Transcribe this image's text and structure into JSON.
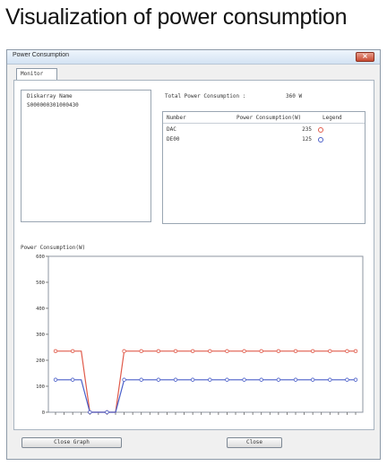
{
  "page_title": "Visualization of power consumption",
  "window": {
    "title": "Power Consumption",
    "close_glyph": "×"
  },
  "tab": {
    "label": "Monitor"
  },
  "list": {
    "header": "Diskarray Name",
    "items": [
      "S000000301000430"
    ]
  },
  "total": {
    "label": "Total Power Consumption :",
    "value": "360 W"
  },
  "table": {
    "headers": [
      "Number",
      "Power Consumption(W)",
      "Legend"
    ],
    "rows": [
      {
        "number": "DAC",
        "power": "235",
        "legend_color": "#e05a4a"
      },
      {
        "number": "DE00",
        "power": "125",
        "legend_color": "#4a5ec8"
      }
    ]
  },
  "chart_label": "Power Consumption(W)",
  "chart_data": {
    "type": "line",
    "ylim": [
      0,
      600
    ],
    "y_ticks": [
      0,
      100,
      200,
      300,
      400,
      500,
      600
    ],
    "x": [
      1,
      2,
      3,
      4,
      5,
      6,
      7,
      8,
      9,
      10,
      11,
      12,
      13,
      14,
      15,
      16,
      17,
      18,
      19,
      20,
      21,
      22,
      23,
      24,
      25,
      26,
      27,
      28,
      29,
      30,
      31,
      32,
      33,
      34,
      35,
      36
    ],
    "series": [
      {
        "color": "#e05a4a",
        "values": [
          235,
          235,
          235,
          235,
          0,
          0,
          0,
          0,
          235,
          235,
          235,
          235,
          235,
          235,
          235,
          235,
          235,
          235,
          235,
          235,
          235,
          235,
          235,
          235,
          235,
          235,
          235,
          235,
          235,
          235,
          235,
          235,
          235,
          235,
          235,
          235
        ]
      },
      {
        "color": "#4a5ec8",
        "values": [
          125,
          125,
          125,
          125,
          0,
          0,
          0,
          0,
          125,
          125,
          125,
          125,
          125,
          125,
          125,
          125,
          125,
          125,
          125,
          125,
          125,
          125,
          125,
          125,
          125,
          125,
          125,
          125,
          125,
          125,
          125,
          125,
          125,
          125,
          125,
          125
        ]
      }
    ],
    "grid": false
  },
  "buttons": {
    "close_graph": "Close Graph",
    "close": "Close"
  }
}
